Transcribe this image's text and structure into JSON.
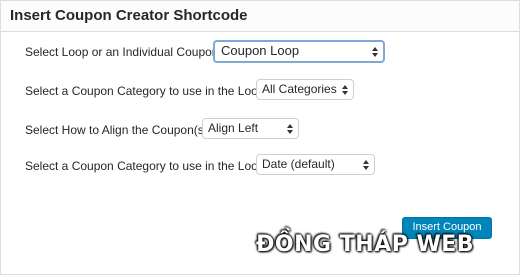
{
  "dialog": {
    "title": "Insert Coupon Creator Shortcode"
  },
  "form": {
    "rows": [
      {
        "label": "Select Loop or an Individual Coupon",
        "value": "Coupon Loop"
      },
      {
        "label": "Select a Coupon Category to use in the Loop",
        "value": "All Categories"
      },
      {
        "label": "Select How to Align the Coupon(s)",
        "value": "Align Left"
      },
      {
        "label": "Select a Coupon Category to use in the Loop",
        "value": "Date (default)"
      }
    ],
    "insert_label": "Insert Coupon"
  },
  "watermark": {
    "text": "ĐỒNG THÁP WEB"
  },
  "colors": {
    "accent": "#0085ba",
    "focus_border": "#7fa7d8"
  },
  "icons": {
    "select_arrows": "up-down-arrows-icon"
  }
}
